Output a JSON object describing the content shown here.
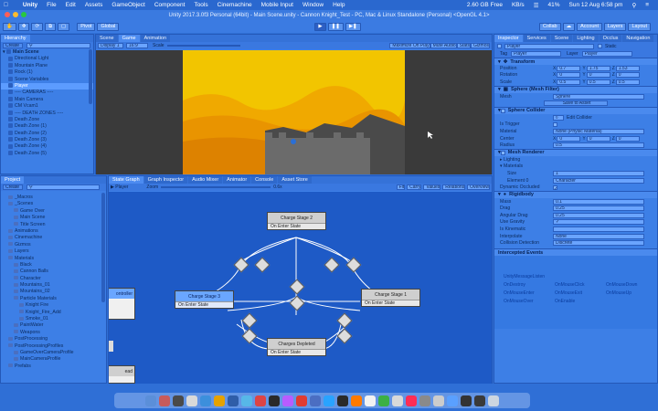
{
  "menubar": {
    "items": [
      "Unity",
      "File",
      "Edit",
      "Assets",
      "GameObject",
      "Component",
      "Tools",
      "Cinemachine",
      "Mobile Input",
      "Window",
      "Help"
    ],
    "memory": "2.60 GB Free",
    "net": "KB/s",
    "battery": "41%",
    "datetime": "Sun 12 Aug  6:58 pm"
  },
  "window": {
    "title": "Unity 2017.3.0f3 Personal (64bit) - Main Scene.unity - Cannon Knight_Test - PC, Mac & Linux Standalone (Personal) <OpenGL 4.1>"
  },
  "toolbar": {
    "pivot": "Pivot",
    "global": "Global",
    "collab": "Collab",
    "account": "Account",
    "layers": "Layers",
    "layout": "Layout"
  },
  "hierarchy": {
    "tab": "Hierarchy",
    "create": "Create",
    "scene": "Main Scene",
    "items": [
      {
        "label": "Directional Light",
        "sel": false
      },
      {
        "label": "Mountain Plane",
        "sel": false
      },
      {
        "label": "Rock (1)",
        "sel": false
      },
      {
        "label": "Scene Variables",
        "sel": false
      },
      {
        "label": "Player",
        "sel": true
      },
      {
        "label": "---- CAMERAS ----",
        "sel": false
      },
      {
        "label": "Main Camera",
        "sel": false
      },
      {
        "label": "CM Vcam1",
        "sel": false
      },
      {
        "label": "---- DEATH ZONES ----",
        "sel": false
      },
      {
        "label": "Death Zone",
        "sel": false
      },
      {
        "label": "Death Zone (1)",
        "sel": false
      },
      {
        "label": "Death Zone (2)",
        "sel": false
      },
      {
        "label": "Death Zone (3)",
        "sel": false
      },
      {
        "label": "Death Zone (4)",
        "sel": false
      },
      {
        "label": "Death Zone (5)",
        "sel": false
      }
    ]
  },
  "scene_tabs": [
    "Scene",
    "Game",
    "Animation"
  ],
  "game_bar": {
    "display": "Display 1",
    "aspect": "16:9",
    "scale": "Scale",
    "maximize": "Maximize On Play",
    "mute": "Mute Audio",
    "stats": "Stats",
    "gizmos": "Gizmos"
  },
  "project": {
    "tab": "Project",
    "create": "Create",
    "items": [
      {
        "label": "_Macros",
        "indent": 1
      },
      {
        "label": "_Scenes",
        "indent": 1
      },
      {
        "label": "Game Over",
        "indent": 2
      },
      {
        "label": "Main Scene",
        "indent": 2
      },
      {
        "label": "Title Screen",
        "indent": 2
      },
      {
        "label": "Animations",
        "indent": 1
      },
      {
        "label": "Cinemachine",
        "indent": 1
      },
      {
        "label": "Gizmos",
        "indent": 1
      },
      {
        "label": "Layers",
        "indent": 1
      },
      {
        "label": "Materials",
        "indent": 1
      },
      {
        "label": "Black",
        "indent": 2
      },
      {
        "label": "Cannon Balls",
        "indent": 2
      },
      {
        "label": "Character",
        "indent": 2
      },
      {
        "label": "Mountains_01",
        "indent": 2
      },
      {
        "label": "Mountains_02",
        "indent": 2
      },
      {
        "label": "Particle Materials",
        "indent": 2
      },
      {
        "label": "Knight Fire",
        "indent": 3
      },
      {
        "label": "Knight_Fire_Add",
        "indent": 3
      },
      {
        "label": "Smoke_01",
        "indent": 3
      },
      {
        "label": "PaintWater",
        "indent": 2
      },
      {
        "label": "Weapons",
        "indent": 2
      },
      {
        "label": "PostProcessing",
        "indent": 1
      },
      {
        "label": "PostProcessingProfiles",
        "indent": 1
      },
      {
        "label": "GameOverCameraProfile",
        "indent": 2
      },
      {
        "label": "MainCameraProfile",
        "indent": 2
      },
      {
        "label": "Prefabs",
        "indent": 1
      }
    ]
  },
  "graph": {
    "tabs": [
      "State Graph",
      "Graph Inspector",
      "Audio Mixer",
      "Animator",
      "Console",
      "Asset Store"
    ],
    "player": "Player",
    "zoom": "Zoom",
    "zoom_val": "0.6x",
    "right_btns": [
      "Fit",
      "Carry",
      "Values",
      "Relations",
      "Overview"
    ],
    "nodes": {
      "charge2": {
        "title": "Charge Stage 2",
        "sub": "On Enter State"
      },
      "charge3": {
        "title": "Charge Stage 3",
        "sub": "On Enter State"
      },
      "charge1": {
        "title": "Charge Stage 1",
        "sub": "On Enter State"
      },
      "depleted": {
        "title": "Charges Depleted",
        "sub": "On Enter State"
      },
      "left_partial": {
        "title": "ontroller",
        "sub": ""
      },
      "left_partial2": {
        "title": "ead",
        "sub": ""
      }
    },
    "diamond_label": "A"
  },
  "inspector": {
    "tabs": [
      "Inspector",
      "Services",
      "Scene",
      "Lighting",
      "Occlus",
      "Navigation"
    ],
    "name": "Player",
    "static": "Static",
    "tag_label": "Tag",
    "tag": "Player",
    "layer_label": "Layer",
    "layer": "Player",
    "transform": {
      "title": "Transform",
      "rows": [
        {
          "label": "Position",
          "x": "0.7",
          "y": "1.75",
          "z": "1.53"
        },
        {
          "label": "Rotation",
          "x": "0",
          "y": "0",
          "z": "0"
        },
        {
          "label": "Scale",
          "x": "0.5",
          "y": "0.5",
          "z": "0.5"
        }
      ]
    },
    "mesh_filter": {
      "title": "Sphere (Mesh Filter)",
      "mesh_label": "Mesh",
      "mesh": "Sphere",
      "save": "Save to Asset"
    },
    "collider": {
      "title": "Sphere Collider",
      "edit": "Edit Collider",
      "is_trigger": "Is Trigger",
      "material_label": "Material",
      "material": "None (Physic Material)",
      "center_label": "Center",
      "cx": "0",
      "cy": "0",
      "cz": "0",
      "radius_label": "Radius",
      "radius": "0.5"
    },
    "renderer": {
      "title": "Mesh Renderer",
      "lighting": "Lighting",
      "materials": "Materials",
      "size_label": "Size",
      "size": "1",
      "element_label": "Element 0",
      "element": "Character",
      "dynamic": "Dynamic Occluded"
    },
    "rigidbody": {
      "title": "Rigidbody",
      "rows": [
        {
          "label": "Mass",
          "value": "0.1"
        },
        {
          "label": "Drag",
          "value": "0.25"
        },
        {
          "label": "Angular Drag",
          "value": "0.25"
        },
        {
          "label": "Use Gravity",
          "value": "✓"
        },
        {
          "label": "Is Kinematic",
          "value": ""
        },
        {
          "label": "Interpolate",
          "value": "None"
        },
        {
          "label": "Collision Detection",
          "value": "Discrete"
        }
      ]
    },
    "events": {
      "header": "Intercepted Events",
      "title": "UnityMessageListen",
      "items": [
        "OnDestroy",
        "OnMouseClick",
        "OnMouseDown",
        "OnMouseEnter",
        "OnMouseExit",
        "OnMouseUp",
        "OnMouseOver",
        "OnEnable"
      ]
    }
  },
  "dock": {
    "colors": [
      "#5b8fd9",
      "#c75b5b",
      "#4a4a4a",
      "#d9d9d9",
      "#3c8fdc",
      "#e6a200",
      "#2f5da8",
      "#57b7e8",
      "#d44",
      "#2a2a2a",
      "#b85cff",
      "#e03c31",
      "#4b6ec2",
      "#29a3ff",
      "#2a2a2a",
      "#ff7a00",
      "#f2f2f2",
      "#3cb043",
      "#d9d9d9",
      "#ff2d55",
      "#8a8a8a",
      "#cccccc",
      "#5aa0ff",
      "#333333",
      "#3a3a3a",
      "#cdd6e0"
    ]
  }
}
